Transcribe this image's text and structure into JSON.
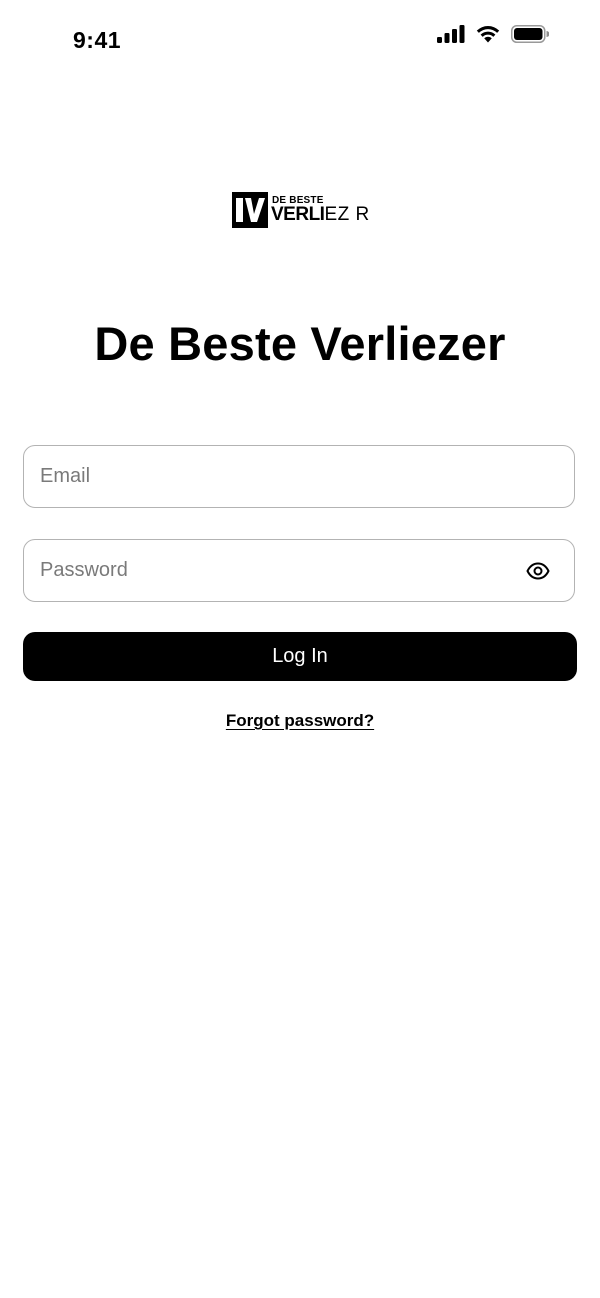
{
  "status_bar": {
    "time": "9:41"
  },
  "logo": {
    "small_text": "DE BESTE",
    "big_text_bold": "VERLI",
    "big_text_light": "EZ R",
    "mark": "1V"
  },
  "title": "De Beste Verliezer",
  "form": {
    "email_placeholder": "Email",
    "password_placeholder": "Password",
    "login_label": "Log In",
    "forgot_label": "Forgot password?"
  },
  "icons": {
    "signal": "cellular-signal-icon",
    "wifi": "wifi-icon",
    "battery": "battery-icon",
    "eye": "eye-icon"
  },
  "colors": {
    "primary": "#000000",
    "background": "#ffffff",
    "border": "#b3b3b3",
    "placeholder": "#7a7a7a"
  }
}
